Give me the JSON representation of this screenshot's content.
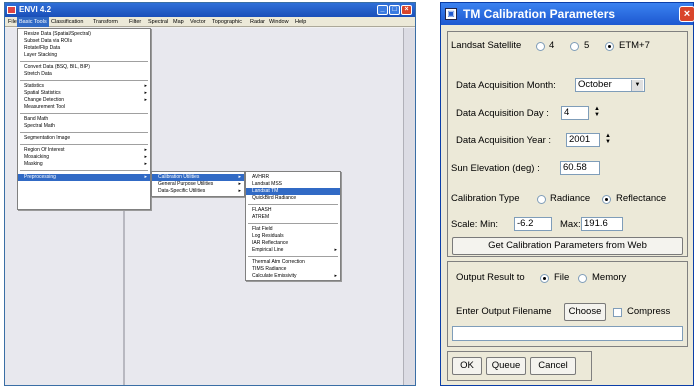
{
  "envi": {
    "title": "ENVI 4.2",
    "menubar": [
      "File",
      "Basic Tools",
      "Classification",
      "Transform",
      "Filter",
      "Spectral",
      "Map",
      "Vector",
      "Topographic",
      "Radar",
      "Window",
      "Help"
    ],
    "basic_tools_menu": [
      "Resize Data (Spatial/Spectral)",
      "Subset Data via ROIs",
      "Rotate/Flip Data",
      "Layer Stacking",
      "Convert Data (BSQ, BIL, BIP)",
      "Stretch Data",
      "Statistics",
      "Spatial Statistics",
      "Change Detection",
      "Measurement Tool",
      "Band Math",
      "Spectral Math",
      "Segmentation Image",
      "Region Of Interest",
      "Mosaicking",
      "Masking",
      "Preprocessing"
    ],
    "preprocessing_menu": [
      "Calibration Utilities",
      "General Purpose Utilities",
      "Data-Specific Utilities"
    ],
    "calibration_menu": [
      "AVHRR",
      "Landsat MSS",
      "Landsat TM",
      "QuickBird Radiance",
      "FLAASH",
      "ATREM",
      "Flat Field",
      "Log Residuals",
      "IAR Reflectance",
      "Empirical Line",
      "Thermal Atm Correction",
      "TIMS Radiance",
      "Calculate Emissivity"
    ]
  },
  "dialog": {
    "title": "TM Calibration Parameters",
    "satellite_label": "Landsat Satellite",
    "satellite_options": [
      "4",
      "5",
      "ETM+7"
    ],
    "month_label": "Data Acquisition Month:",
    "month_value": "October",
    "day_label": "Data Acquisition Day :",
    "day_value": "4",
    "year_label": "Data Acquisition Year :",
    "year_value": "2001",
    "sun_label": "Sun Elevation (deg)  :",
    "sun_value": "60.58",
    "caltype_label": "Calibration Type",
    "caltype_options": [
      "Radiance",
      "Reflectance"
    ],
    "scale_label": "Scale:  Min:",
    "scale_min": "-6.2",
    "max_label": "Max:",
    "scale_max": "191.6",
    "web_button": "Get Calibration Parameters from Web",
    "output_label": "Output Result to",
    "output_options": [
      "File",
      "Memory"
    ],
    "filename_label": "Enter Output Filename",
    "choose_button": "Choose",
    "compress_label": "Compress",
    "filename_value": "",
    "ok_button": "OK",
    "queue_button": "Queue",
    "cancel_button": "Cancel"
  }
}
